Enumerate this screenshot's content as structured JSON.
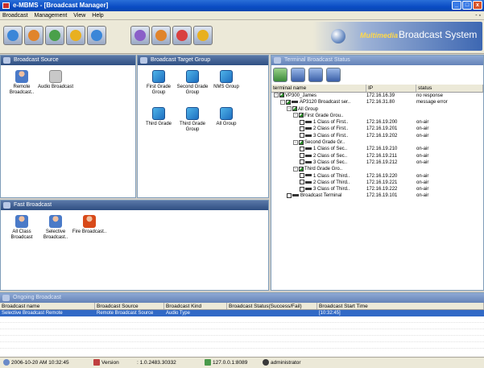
{
  "window": {
    "title": "e-MBMS - [Broadcast Manager]"
  },
  "menu": {
    "items": [
      "Broadcast",
      "Management",
      "View",
      "Help"
    ],
    "mdi_controls": "- ̅"
  },
  "brand": {
    "multimedia": "Multimedia",
    "broadcast_system": "Broadcast System"
  },
  "source_panel": {
    "title": "Broadcast Source",
    "items": [
      {
        "label": "Remote Broadcast.."
      },
      {
        "label": "Audio Broadcast"
      }
    ]
  },
  "target_panel": {
    "title": "Broadcast Target Group",
    "items": [
      {
        "label": "First Grade Group"
      },
      {
        "label": "Second Grade Group"
      },
      {
        "label": "NMS Group"
      },
      {
        "label": "Third Grade"
      },
      {
        "label": "Third Grade Group"
      },
      {
        "label": "All Group"
      }
    ]
  },
  "fast_panel": {
    "title": "Fast Broadcast",
    "items": [
      {
        "label": "All Class Broadcast"
      },
      {
        "label": "Selective Broadcast.."
      },
      {
        "label": "Fire Broadcast.."
      }
    ]
  },
  "status_panel": {
    "title": "Terminal Broadcast Status",
    "columns": [
      "terminal name",
      "IP",
      "status"
    ],
    "rows": [
      {
        "indent": 0,
        "node": "-",
        "check": true,
        "name": "VP300_James",
        "ip": "172.16.16.39",
        "status": "no response"
      },
      {
        "indent": 1,
        "node": "-",
        "check": true,
        "bar": true,
        "name": "AP3120 Broadcast ser..",
        "ip": "172.16.31.80",
        "status": "message error"
      },
      {
        "indent": 2,
        "node": "-",
        "check": true,
        "name": "All Group",
        "ip": "",
        "status": ""
      },
      {
        "indent": 3,
        "node": "-",
        "check": true,
        "name": "First Grade Grou..",
        "ip": "",
        "status": ""
      },
      {
        "indent": 4,
        "node": "",
        "check": false,
        "bar": true,
        "name": "1 Class of First..",
        "ip": "172.16.19.200",
        "status": "on-air"
      },
      {
        "indent": 4,
        "node": "",
        "check": false,
        "bar": true,
        "name": "2 Class of First..",
        "ip": "172.16.19.201",
        "status": "on-air"
      },
      {
        "indent": 4,
        "node": "",
        "check": false,
        "bar": true,
        "name": "3 Class of First..",
        "ip": "172.16.19.202",
        "status": "on-air"
      },
      {
        "indent": 3,
        "node": "-",
        "check": true,
        "name": "Second Grade Gr..",
        "ip": "",
        "status": ""
      },
      {
        "indent": 4,
        "node": "",
        "check": false,
        "bar": true,
        "name": "1 Class of Sec..",
        "ip": "172.16.19.210",
        "status": "on-air"
      },
      {
        "indent": 4,
        "node": "",
        "check": false,
        "bar": true,
        "name": "2 Class of Sec..",
        "ip": "172.16.19.211",
        "status": "on-air"
      },
      {
        "indent": 4,
        "node": "",
        "check": false,
        "bar": true,
        "name": "3 Class of Sec..",
        "ip": "172.16.19.212",
        "status": "on-air"
      },
      {
        "indent": 3,
        "node": "-",
        "check": true,
        "name": "Third Grade Gro..",
        "ip": "",
        "status": ""
      },
      {
        "indent": 4,
        "node": "",
        "check": false,
        "bar": true,
        "name": "1 Class of Third..",
        "ip": "172.16.19.220",
        "status": "on-air"
      },
      {
        "indent": 4,
        "node": "",
        "check": false,
        "bar": true,
        "name": "2 Class of Third..",
        "ip": "172.16.19.221",
        "status": "on-air"
      },
      {
        "indent": 4,
        "node": "",
        "check": false,
        "bar": true,
        "name": "3 Class of Third..",
        "ip": "172.16.19.222",
        "status": "on-air"
      },
      {
        "indent": 2,
        "node": "",
        "check": false,
        "bar": true,
        "name": "Broadcast Terminal",
        "ip": "172.16.19.101",
        "status": "on-air"
      }
    ]
  },
  "ongoing_panel": {
    "title": "Ongoing Broadcast",
    "columns": [
      "Broadcast name",
      "Broadcast Source",
      "Broadcast Kind",
      "Broadcast Status(Success/Fail)",
      "Broadcast Start Time"
    ],
    "rows": [
      [
        "Selective Broadcast Remote",
        "Remote Broadcast Source",
        "Audio Type",
        "",
        "[10:32:45]"
      ]
    ]
  },
  "statusbar": {
    "datetime": "2006-10-20  AM 10:32:45",
    "version_label": "Version",
    "version_value": ": 1.0.2483.30332",
    "server": "127.0.0.1:8089",
    "user": "administrator"
  }
}
